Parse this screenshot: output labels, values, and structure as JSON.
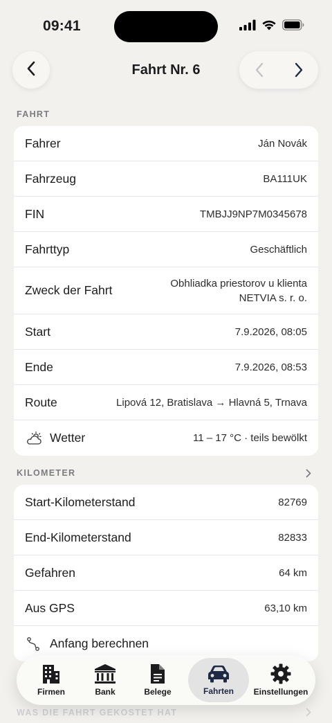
{
  "status_bar": {
    "time": "09:41"
  },
  "nav": {
    "title": "Fahrt Nr. 6"
  },
  "sections": {
    "trip_header": "FAHRT",
    "km_header": "KILOMETER",
    "cost_header": "WAS DIE FAHRT GEKOSTET HAT"
  },
  "trip": {
    "driver": {
      "label": "Fahrer",
      "value": "Ján Novák"
    },
    "vehicle": {
      "label": "Fahrzeug",
      "value": "BA111UK"
    },
    "vin": {
      "label": "FIN",
      "value": "TMBJJ9NP7M0345678"
    },
    "trip_type": {
      "label": "Fahrttyp",
      "value": "Geschäftlich"
    },
    "purpose": {
      "label": "Zweck der Fahrt",
      "value_line1": "Obhliadka priestorov u klienta",
      "value_line2": "NETVIA s. r. o."
    },
    "start": {
      "label": "Start",
      "value": "7.9.2026, 08:05"
    },
    "end": {
      "label": "Ende",
      "value": "7.9.2026, 08:53"
    },
    "route": {
      "label": "Route",
      "value": "Lipová 12, Bratislava → Hlavná 5, Trnava"
    },
    "weather": {
      "label": "Wetter",
      "value": "11 – 17 °C · teils bewölkt",
      "icon": "cloud-sun-icon"
    }
  },
  "km": {
    "start_odometer": {
      "label": "Start-Kilometerstand",
      "value": "82769"
    },
    "end_odometer": {
      "label": "End-Kilometerstand",
      "value": "82833"
    },
    "driven": {
      "label": "Gefahren",
      "value": "64 km"
    },
    "gps": {
      "label": "Aus GPS",
      "value": "63,10 km"
    },
    "calc_start": {
      "label": "Anfang berechnen",
      "icon": "route-icon"
    }
  },
  "tabs": [
    {
      "label": "Firmen",
      "icon": "building-icon"
    },
    {
      "label": "Bank",
      "icon": "bank-icon"
    },
    {
      "label": "Belege",
      "icon": "document-icon"
    },
    {
      "label": "Fahrten",
      "icon": "car-icon",
      "active": true
    },
    {
      "label": "Einstellungen",
      "icon": "gear-icon"
    }
  ],
  "colors": {
    "background": "#f2f1ee",
    "card": "#ffffff",
    "accent": "#1e2a44",
    "section_header": "#7c7c80"
  }
}
